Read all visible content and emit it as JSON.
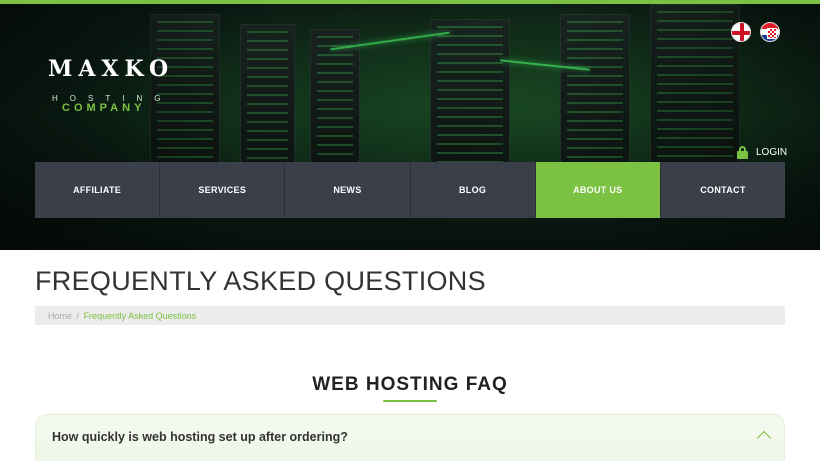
{
  "brand": {
    "logo_text": "MAXKO",
    "logo_hosting": "HOSTING",
    "logo_company": "COMPANY"
  },
  "languages": [
    {
      "name": "english-flag-icon"
    },
    {
      "name": "croatian-flag-icon"
    }
  ],
  "login": {
    "label": "LOGIN",
    "icon": "lock-icon"
  },
  "nav": {
    "items": [
      {
        "label": "AFFILIATE"
      },
      {
        "label": "SERVICES"
      },
      {
        "label": "NEWS"
      },
      {
        "label": "BLOG"
      },
      {
        "label": "ABOUT US",
        "active": true
      },
      {
        "label": "CONTACT"
      }
    ]
  },
  "page": {
    "title": "FREQUENTLY ASKED QUESTIONS",
    "breadcrumb": {
      "home": "Home",
      "separator": "/",
      "current": "Frequently Asked Questions"
    }
  },
  "faq_section": {
    "title": "WEB HOSTING FAQ",
    "items": [
      {
        "question": "How quickly is web hosting set up after ordering?",
        "toggle_icon": "chevron-up-icon"
      }
    ]
  },
  "colors": {
    "accent": "#7bc142",
    "nav_bg": "#3a3f4a"
  }
}
